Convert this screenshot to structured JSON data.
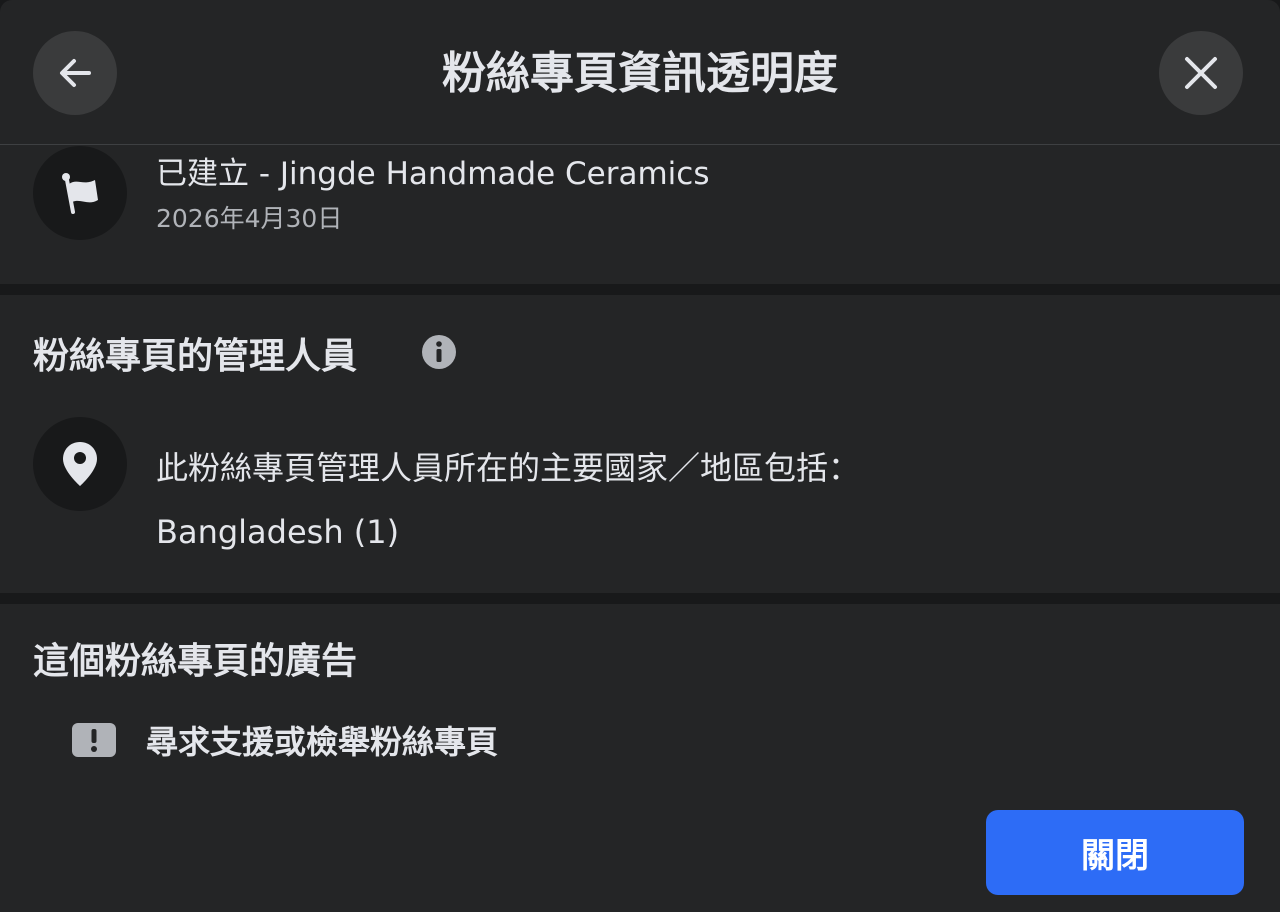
{
  "header": {
    "title": "粉絲專頁資訊透明度",
    "back_icon": "arrow-left-icon",
    "close_icon": "close-icon"
  },
  "created": {
    "icon": "flag-icon",
    "title": "已建立 - Jingde Handmade Ceramics",
    "date": "2026年4月30日"
  },
  "admins": {
    "heading": "粉絲專頁的管理人員",
    "info_icon": "info-icon",
    "location_icon": "location-pin-icon",
    "description": "此粉絲專頁管理人員所在的主要國家／地區包括：",
    "country": "Bangladesh (1)"
  },
  "ads": {
    "heading": "這個粉絲專頁的廣告",
    "report_icon": "exclamation-icon",
    "report_label": "尋求支援或檢舉粉絲專頁"
  },
  "footer": {
    "close_label": "關閉"
  },
  "colors": {
    "background": "#242526",
    "divider": "#18191a",
    "primary_button": "#2d6cf6",
    "text_primary": "#e4e6eb",
    "text_secondary": "#b0b3b8"
  }
}
